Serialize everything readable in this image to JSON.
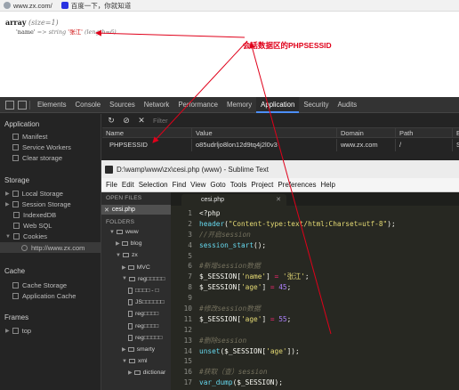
{
  "browser_tabs": [
    {
      "label": "www.zx.com/",
      "icon": "page-icon"
    },
    {
      "label": "百度一下，你就知道",
      "icon": "baidu-paw-icon"
    }
  ],
  "page": {
    "dump_line1_type": "array",
    "dump_line1_size": "(size=1)",
    "dump_key": "'name'",
    "dump_arrow": "=>",
    "dump_type": "string",
    "dump_value": "'张江'",
    "dump_length": "(length=6)",
    "annotation": "会话数据区的PHPSESSID"
  },
  "devtools": {
    "tabs": [
      "Elements",
      "Console",
      "Sources",
      "Network",
      "Performance",
      "Memory",
      "Application",
      "Security",
      "Audits"
    ],
    "active_tab": "Application",
    "sidebar": {
      "application_header": "Application",
      "application_items": [
        "Manifest",
        "Service Workers",
        "Clear storage"
      ],
      "storage_header": "Storage",
      "storage_items": [
        "Local Storage",
        "Session Storage",
        "IndexedDB",
        "Web SQL",
        "Cookies"
      ],
      "cookie_origin": "http://www.zx.com",
      "cache_header": "Cache",
      "cache_items": [
        "Cache Storage",
        "Application Cache"
      ],
      "frames_header": "Frames",
      "frames_items": [
        "top"
      ]
    },
    "toolbar": {
      "refresh": "↻",
      "clear": "⊘",
      "delete": "✕",
      "filter_placeholder": "Filter"
    },
    "grid": {
      "columns": [
        "Name",
        "Value",
        "Domain",
        "Path",
        "E"
      ],
      "rows": [
        [
          "PHPSESSID",
          "o85udrljo8lon12d9tq4j2l0v3",
          "www.zx.com",
          "/",
          "S"
        ]
      ]
    }
  },
  "sublime": {
    "title": "D:\\wamp\\www\\zx\\cesi.php (www) - Sublime Text",
    "menu": [
      "File",
      "Edit",
      "Selection",
      "Find",
      "View",
      "Goto",
      "Tools",
      "Project",
      "Preferences",
      "Help"
    ],
    "open_files_header": "OPEN FILES",
    "open_file": "cesi.php",
    "folders_header": "FOLDERS",
    "tree": [
      {
        "label": "www",
        "type": "folder",
        "depth": 1,
        "open": true
      },
      {
        "label": "blog",
        "type": "folder",
        "depth": 2,
        "open": false
      },
      {
        "label": "zx",
        "type": "folder",
        "depth": 2,
        "open": true
      },
      {
        "label": "MVC",
        "type": "folder",
        "depth": 3,
        "open": false
      },
      {
        "label": "reg□□□□□",
        "type": "folder",
        "depth": 3,
        "open": true
      },
      {
        "label": "□□□□ - □",
        "type": "file",
        "depth": 4
      },
      {
        "label": "JS□□□□□□",
        "type": "file",
        "depth": 4
      },
      {
        "label": "reg□□□□",
        "type": "file",
        "depth": 4
      },
      {
        "label": "reg□□□□",
        "type": "file",
        "depth": 4
      },
      {
        "label": "reg□□□□□",
        "type": "file",
        "depth": 4
      },
      {
        "label": "smarty",
        "type": "folder",
        "depth": 3,
        "open": false
      },
      {
        "label": "xml",
        "type": "folder",
        "depth": 3,
        "open": true
      },
      {
        "label": "dictionar",
        "type": "folder",
        "depth": 4,
        "open": false
      }
    ],
    "tab_label": "cesi.php",
    "line_numbers": [
      "1",
      "2",
      "3",
      "4",
      "5",
      "6",
      "7",
      "8",
      "9",
      "10",
      "11",
      "12",
      "13",
      "14",
      "15",
      "16",
      "17",
      "18"
    ],
    "code_lines": [
      "<?php",
      "header(\"Content-type:text/html;Charset=utf-8\");",
      "//开启session",
      "session_start();",
      "",
      "#新增session数据",
      "$_SESSION['name'] = '张江';",
      "$_SESSION['age'] = 45;",
      "",
      "#修改session数据",
      "$_SESSION['age'] = 55;",
      "",
      "#删除session",
      "unset($_SESSION['age']);",
      "",
      "#获取（查）session",
      "var_dump($_SESSION);",
      ""
    ]
  },
  "colors": {
    "annotation_red": "#e0001a",
    "monokai_bg": "#272822",
    "devtools_bg": "#242424",
    "active_tab_underline": "#4c8ef7"
  }
}
